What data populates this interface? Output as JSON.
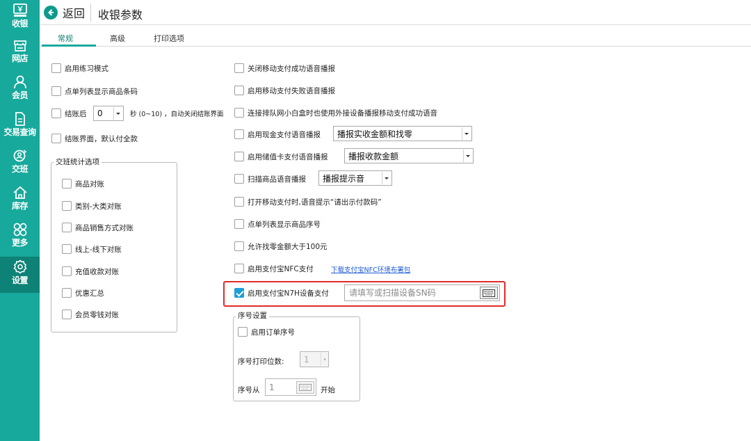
{
  "sidebar": {
    "items": [
      {
        "label": "收银",
        "icon": "cashier-icon"
      },
      {
        "label": "网店",
        "icon": "store-icon"
      },
      {
        "label": "会员",
        "icon": "member-icon"
      },
      {
        "label": "交易查询",
        "icon": "document-icon"
      },
      {
        "label": "交班",
        "icon": "shift-icon"
      },
      {
        "label": "库存",
        "icon": "home-icon"
      },
      {
        "label": "更多",
        "icon": "grid-icon"
      },
      {
        "label": "设置",
        "icon": "gear-icon"
      }
    ],
    "active": "设置",
    "bg_color": "#17a99b"
  },
  "header": {
    "back_label": "返回",
    "title": "收银参数"
  },
  "tabs": [
    {
      "label": "常规",
      "active": true
    },
    {
      "label": "高级",
      "active": false
    },
    {
      "label": "打印选项",
      "active": false
    }
  ],
  "left": {
    "practice_mode": {
      "label": "启用练习模式",
      "checked": false
    },
    "show_barcode": {
      "label": "点单列表显示商品条码",
      "checked": false
    },
    "auto_close": {
      "label_pre": "结账后",
      "value": "0",
      "label_post": "秒 (0~10) ，自动关闭结账界面",
      "checked": false
    },
    "default_full_pay": {
      "label": "结账界面，默认付全款",
      "checked": false
    },
    "shift_group": {
      "title": "交班统计选项",
      "items": [
        {
          "label": "商品对账",
          "checked": false
        },
        {
          "label": "类别-大类对账",
          "checked": false
        },
        {
          "label": "商品销售方式对账",
          "checked": false
        },
        {
          "label": "线上-线下对账",
          "checked": false
        },
        {
          "label": "充值收款对账",
          "checked": false
        },
        {
          "label": "优惠汇总",
          "checked": false
        },
        {
          "label": "会员零钱对账",
          "checked": false
        }
      ]
    }
  },
  "right": {
    "close_mobile_success_voice": {
      "label": "关闭移动支付成功语音播报",
      "checked": false
    },
    "mobile_fail_voice": {
      "label": "启用移动支付失败语音播报",
      "checked": false
    },
    "external_device_voice": {
      "label": "连接排队网小白盒时也使用外接设备播报移动支付成功语音",
      "checked": false
    },
    "cash_voice": {
      "label": "启用现金支付语音播报",
      "select": "播报实收金额和找零",
      "checked": false
    },
    "stored_card_voice": {
      "label": "启用储值卡支付语音播报",
      "select": "播报收款金额",
      "checked": false
    },
    "scan_voice": {
      "label": "扫描商品语音播报",
      "select": "播报提示音",
      "checked": false
    },
    "show_code_prompt": {
      "label": "打开移动支付时,语音提示“请出示付款码”",
      "checked": false
    },
    "show_serial": {
      "label": "点单列表显示商品序号",
      "checked": false
    },
    "allow_change_over": {
      "label": "允许找零金额大于100元",
      "checked": false
    },
    "alipay_nfc": {
      "label": "启用支付宝NFC支付",
      "link": "下载支付宝NFC环境布署包",
      "checked": false
    },
    "alipay_n7h": {
      "label": "启用支付宝N7H设备支付",
      "placeholder": "请填写或扫描设备SN码",
      "checked": true
    },
    "serial_group": {
      "title": "序号设置",
      "enable_order_no": {
        "label": "启用订单序号",
        "checked": false
      },
      "print_digits_label": "序号打印位数:",
      "print_digits_value": "1",
      "start_from_label": "序号从",
      "start_from_value": "1",
      "start_suffix": "开始"
    }
  },
  "colors": {
    "accent": "#17a99b",
    "highlight_border": "#e02a2a",
    "checkbox_checked": "#1b9fd6",
    "link": "#1a5ad6"
  }
}
